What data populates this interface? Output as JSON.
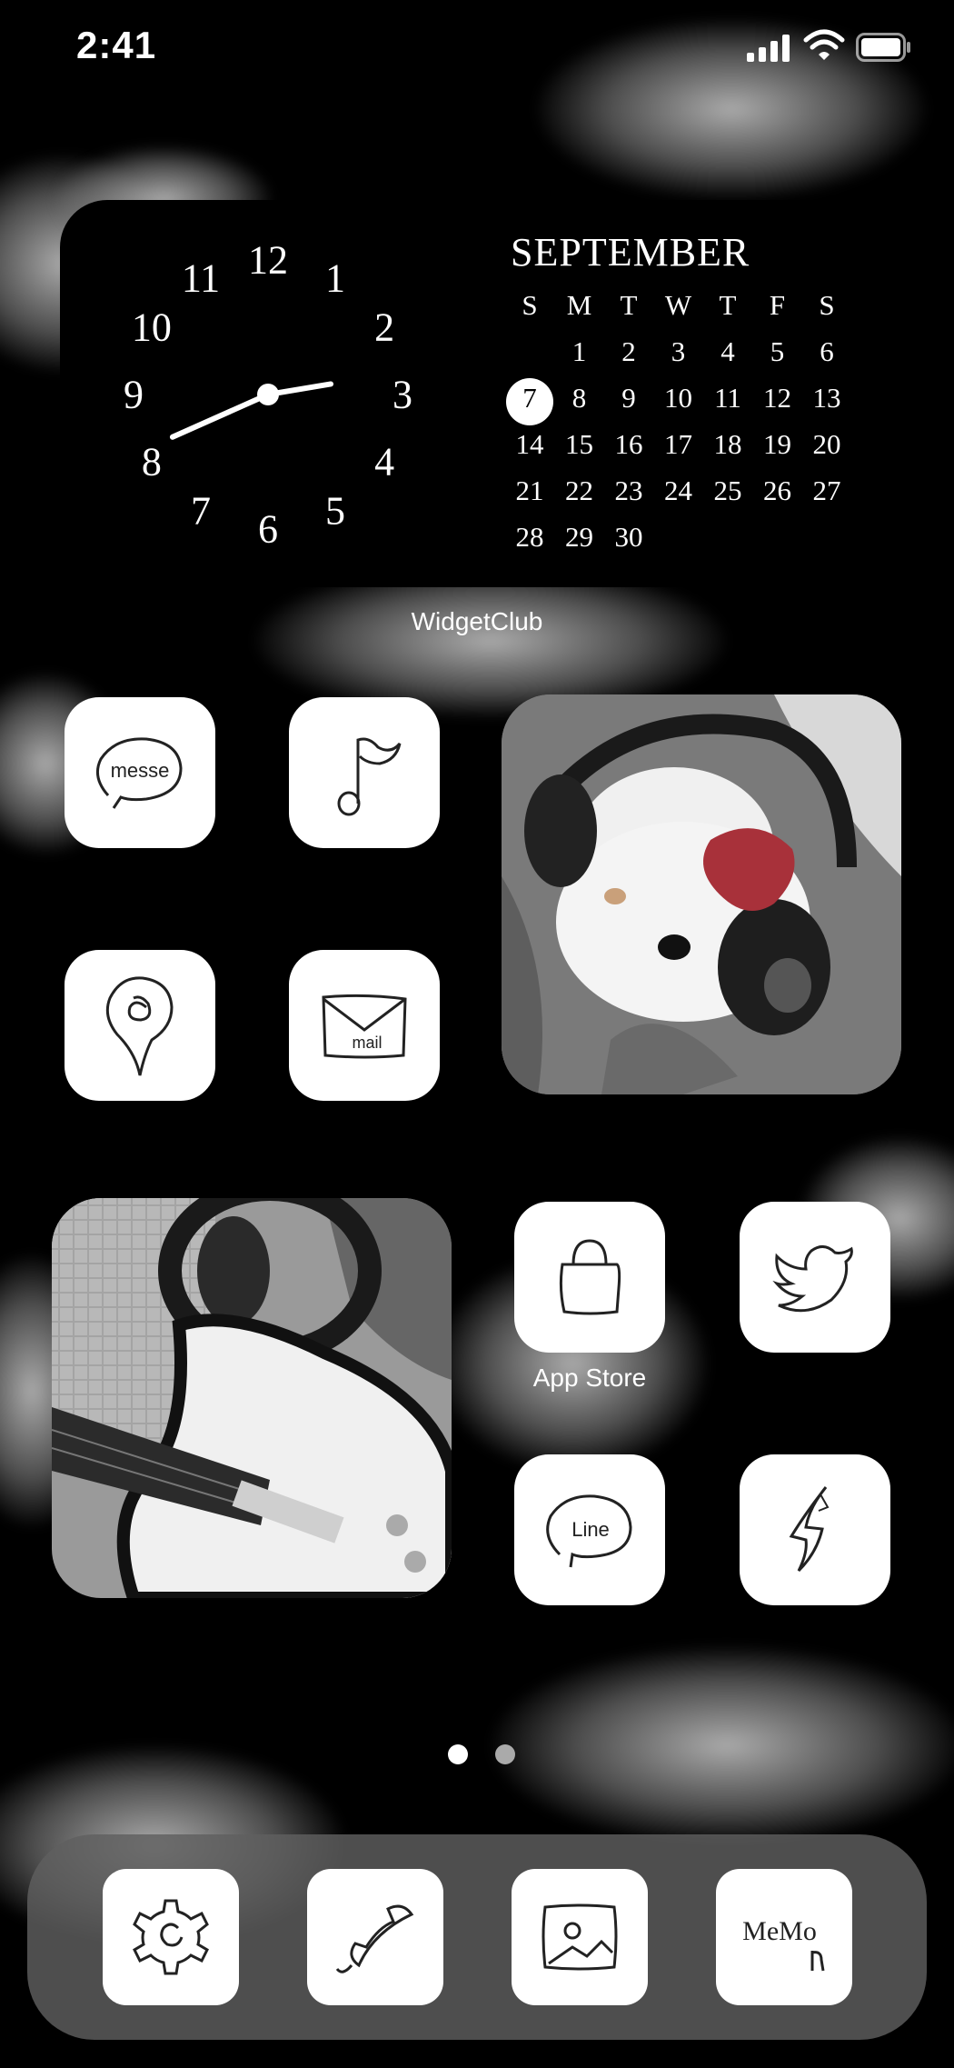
{
  "status_bar": {
    "time": "2:41"
  },
  "clock": {
    "hour_labels": [
      "12",
      "1",
      "2",
      "3",
      "4",
      "5",
      "6",
      "7",
      "8",
      "9",
      "10",
      "11"
    ],
    "hour": 2,
    "minute": 41
  },
  "calendar": {
    "month": "SEPTEMBER",
    "weekdays": [
      "S",
      "M",
      "T",
      "W",
      "T",
      "F",
      "S"
    ],
    "weeks": [
      [
        "",
        "1",
        "2",
        "3",
        "4",
        "5",
        "6"
      ],
      [
        "7",
        "8",
        "9",
        "10",
        "11",
        "12",
        "13"
      ],
      [
        "14",
        "15",
        "16",
        "17",
        "18",
        "19",
        "20"
      ],
      [
        "21",
        "22",
        "23",
        "24",
        "25",
        "26",
        "27"
      ],
      [
        "28",
        "29",
        "30",
        "",
        "",
        "",
        ""
      ]
    ],
    "today": "7"
  },
  "widget_label": "WidgetClub",
  "apps": {
    "messages": {
      "icon": "messages-icon",
      "text": "messe"
    },
    "music": {
      "icon": "music-note-icon"
    },
    "maps": {
      "icon": "map-pin-icon"
    },
    "mail": {
      "icon": "mail-icon",
      "text": "mail"
    },
    "app_store": {
      "icon": "shopping-bag-icon",
      "label": "App Store"
    },
    "twitter": {
      "icon": "bird-icon"
    },
    "line": {
      "icon": "line-chat-icon",
      "text": "Line"
    },
    "shortcut": {
      "icon": "lightning-icon"
    }
  },
  "dock": {
    "settings": {
      "icon": "gear-icon"
    },
    "phone": {
      "icon": "phone-icon"
    },
    "photos": {
      "icon": "photo-icon"
    },
    "memo": {
      "icon": "memo-icon",
      "text": "MeMo"
    }
  },
  "page_indicator": {
    "count": 2,
    "active": 1
  },
  "colors": {
    "background": "#000000",
    "icon_bg": "#ffffff",
    "dock_bg": "#5f5f5f"
  }
}
